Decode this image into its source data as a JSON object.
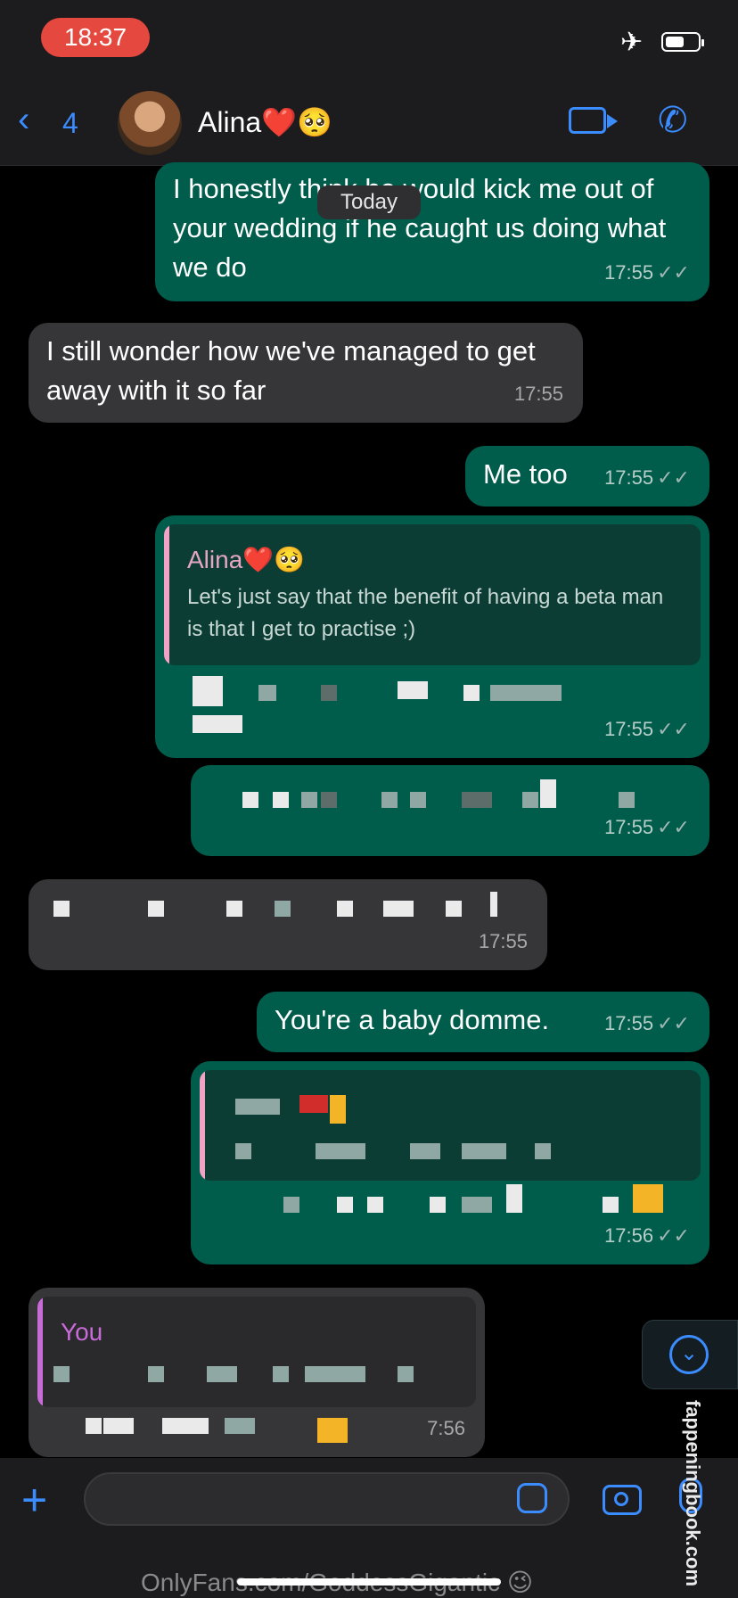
{
  "status": {
    "time": "18:37",
    "airplane_icon": "airplane-icon",
    "battery_icon": "battery-icon"
  },
  "header": {
    "back_count": "4",
    "contact_name": "Alina❤️🥺"
  },
  "date_chip": "Today",
  "messages": {
    "m1": {
      "text": "I honestly think he would kick me out of your wedding if he caught us doing what we do",
      "time": "17:55"
    },
    "m2": {
      "text": "I still wonder how we've managed to get away with it so far",
      "time": "17:55"
    },
    "m3": {
      "text": "Me too",
      "time": "17:55"
    },
    "m4": {
      "quote_name": "Alina❤️🥺",
      "quote_text": "Let's just say that the benefit of having a beta man is that I get to practise ;)",
      "time": "17:55"
    },
    "m5": {
      "time": "17:55"
    },
    "m6": {
      "time": "17:55"
    },
    "m7": {
      "text": "You're a baby domme.",
      "time": "17:55"
    },
    "m8": {
      "time": "17:56"
    },
    "m9": {
      "quote_name": "You",
      "time": "7:56"
    }
  },
  "ticks": "✓✓",
  "colors": {
    "accent": "#3b8cff",
    "outgoing": "#005c4b",
    "incoming": "#363638"
  },
  "watermark": "OnlyFans.com/GoddessGigantic 😉",
  "side_watermark": "fappeningbook.com"
}
